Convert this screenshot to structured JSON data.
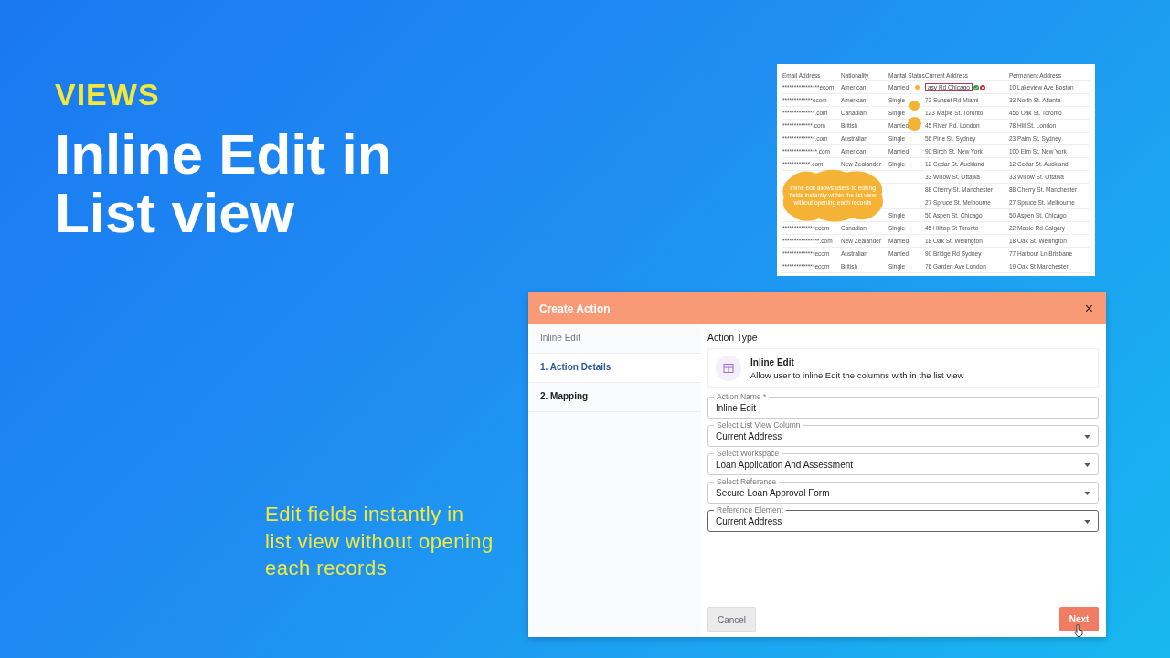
{
  "heading": {
    "eyebrow": "VIEWS",
    "title": "Inline Edit in List view"
  },
  "caption": [
    "Edit fields instantly in",
    "list view without opening",
    "each records"
  ],
  "list_preview": {
    "columns": [
      "Email Address",
      "Nationality",
      "Marital Status",
      "Current Address",
      "Permanent Address"
    ],
    "rows": [
      {
        "editing": true,
        "cells": [
          "****************ecom",
          "American",
          "Married",
          "asy Rd Chicago",
          "10 Lakeview Ave Boston"
        ]
      },
      {
        "editing": false,
        "cells": [
          "*************ecom",
          "American",
          "Single",
          "72 Sunset Rd Miami",
          "33 North St. Atlanta"
        ]
      },
      {
        "editing": false,
        "cells": [
          "**************.com",
          "Canadian",
          "Single",
          "123 Maple St. Toronto",
          "456 Oak St. Toronto"
        ]
      },
      {
        "editing": false,
        "cells": [
          "*************.com",
          "British",
          "Married",
          "45 River Rd. London",
          "78 Hill St. London"
        ]
      },
      {
        "editing": false,
        "cells": [
          "**************.com",
          "Australian",
          "Single",
          "56 Pine St. Sydney",
          "23 Palm St. Sydney"
        ]
      },
      {
        "editing": false,
        "cells": [
          "***************.com",
          "American",
          "Married",
          "90 Birch St. New York",
          "100 Elm St. New York"
        ]
      },
      {
        "editing": false,
        "cells": [
          "************.com",
          "New Zealander",
          "Single",
          "12 Cedar St. Auckland",
          "12 Cedar St. Auckland"
        ]
      },
      {
        "editing": false,
        "cells": [
          "",
          "",
          "",
          "33 Willow St. Ottawa",
          "33 Willow St. Ottawa"
        ]
      },
      {
        "editing": false,
        "cells": [
          "",
          "",
          "",
          "88 Cherry St. Manchester",
          "88 Cherry St. Manchester"
        ]
      },
      {
        "editing": false,
        "cells": [
          "",
          "",
          "",
          "27 Spruce St. Melbourne",
          "27 Spruce St. Melbourne"
        ]
      },
      {
        "editing": false,
        "cells": [
          "",
          "",
          "Single",
          "50 Aspen St. Chicago",
          "50 Aspen St. Chicago"
        ]
      },
      {
        "editing": false,
        "cells": [
          "**************ecom",
          "Canadian",
          "Single",
          "45 Hilltop St Toronto",
          "22 Maple Rd Calgary"
        ]
      },
      {
        "editing": false,
        "cells": [
          "****************.com",
          "New Zealander",
          "Married",
          "18 Oak St. Wellington",
          "18 Oak St. Wellington"
        ]
      },
      {
        "editing": false,
        "cells": [
          "**************ecom",
          "Australian",
          "Married",
          "90 Bridge Rd Sydney",
          "77 Harbour Ln Brisbane"
        ]
      },
      {
        "editing": false,
        "cells": [
          "**************ecom",
          "British",
          "Single",
          "76 Garden Ave London",
          "19 Oak St Manchester"
        ]
      }
    ],
    "callout": "Inline edit allows users to  editing fields instantly within the list view without opening each records"
  },
  "dialog": {
    "title": "Create Action",
    "close": "×",
    "nav": {
      "heading": "Inline Edit",
      "items": [
        {
          "label": "1. Action Details",
          "selected": true
        },
        {
          "label": "2. Mapping",
          "selected": false
        }
      ]
    },
    "section_label": "Action Type",
    "action_type": {
      "title": "Inline Edit",
      "description": "Allow user to inline Edit the columns with in the list view"
    },
    "fields": [
      {
        "kind": "text",
        "label": "Action Name *",
        "value": "Inline Edit",
        "focused": false
      },
      {
        "kind": "select",
        "label": "Select List View Column",
        "value": "Current Address",
        "focused": false
      },
      {
        "kind": "select",
        "label": "Select Workspace",
        "value": "Loan Application And Assessment",
        "focused": false
      },
      {
        "kind": "select",
        "label": "Select Reference",
        "value": "Secure Loan Approval Form",
        "focused": false
      },
      {
        "kind": "select",
        "label": "Reference Element",
        "value": "Current Address",
        "focused": true
      }
    ],
    "buttons": {
      "cancel": "Cancel",
      "next": "Next"
    }
  }
}
